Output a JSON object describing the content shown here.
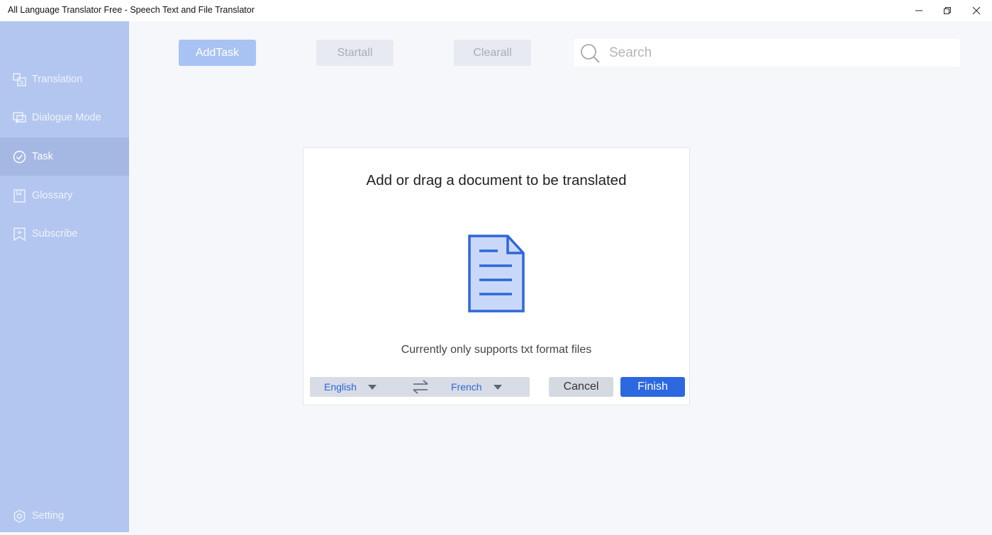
{
  "window": {
    "title": "All Language Translator Free - Speech Text and File Translator"
  },
  "sidebar": {
    "items": [
      {
        "label": "Translation",
        "icon": "translate-icon"
      },
      {
        "label": "Dialogue Mode",
        "icon": "dialogue-icon"
      },
      {
        "label": "Task",
        "icon": "check-circle-icon",
        "active": true
      },
      {
        "label": "Glossary",
        "icon": "book-icon"
      },
      {
        "label": "Subscribe",
        "icon": "bookmark-plus-icon"
      }
    ],
    "setting_label": "Setting"
  },
  "toolbar": {
    "add_task": "AddTask",
    "start_all": "Startall",
    "clear_all": "Clearall",
    "search_placeholder": "Search"
  },
  "dialog": {
    "heading": "Add or drag a document to be translated",
    "hint": "Currently only supports txt format files",
    "source_language": "English",
    "target_language": "French",
    "cancel_label": "Cancel",
    "finish_label": "Finish"
  },
  "colors": {
    "sidebar": "#b3c6ef",
    "accent": "#2c68e0",
    "doc_icon_fill": "#c9d8f8",
    "doc_icon_stroke": "#2f66d9"
  }
}
